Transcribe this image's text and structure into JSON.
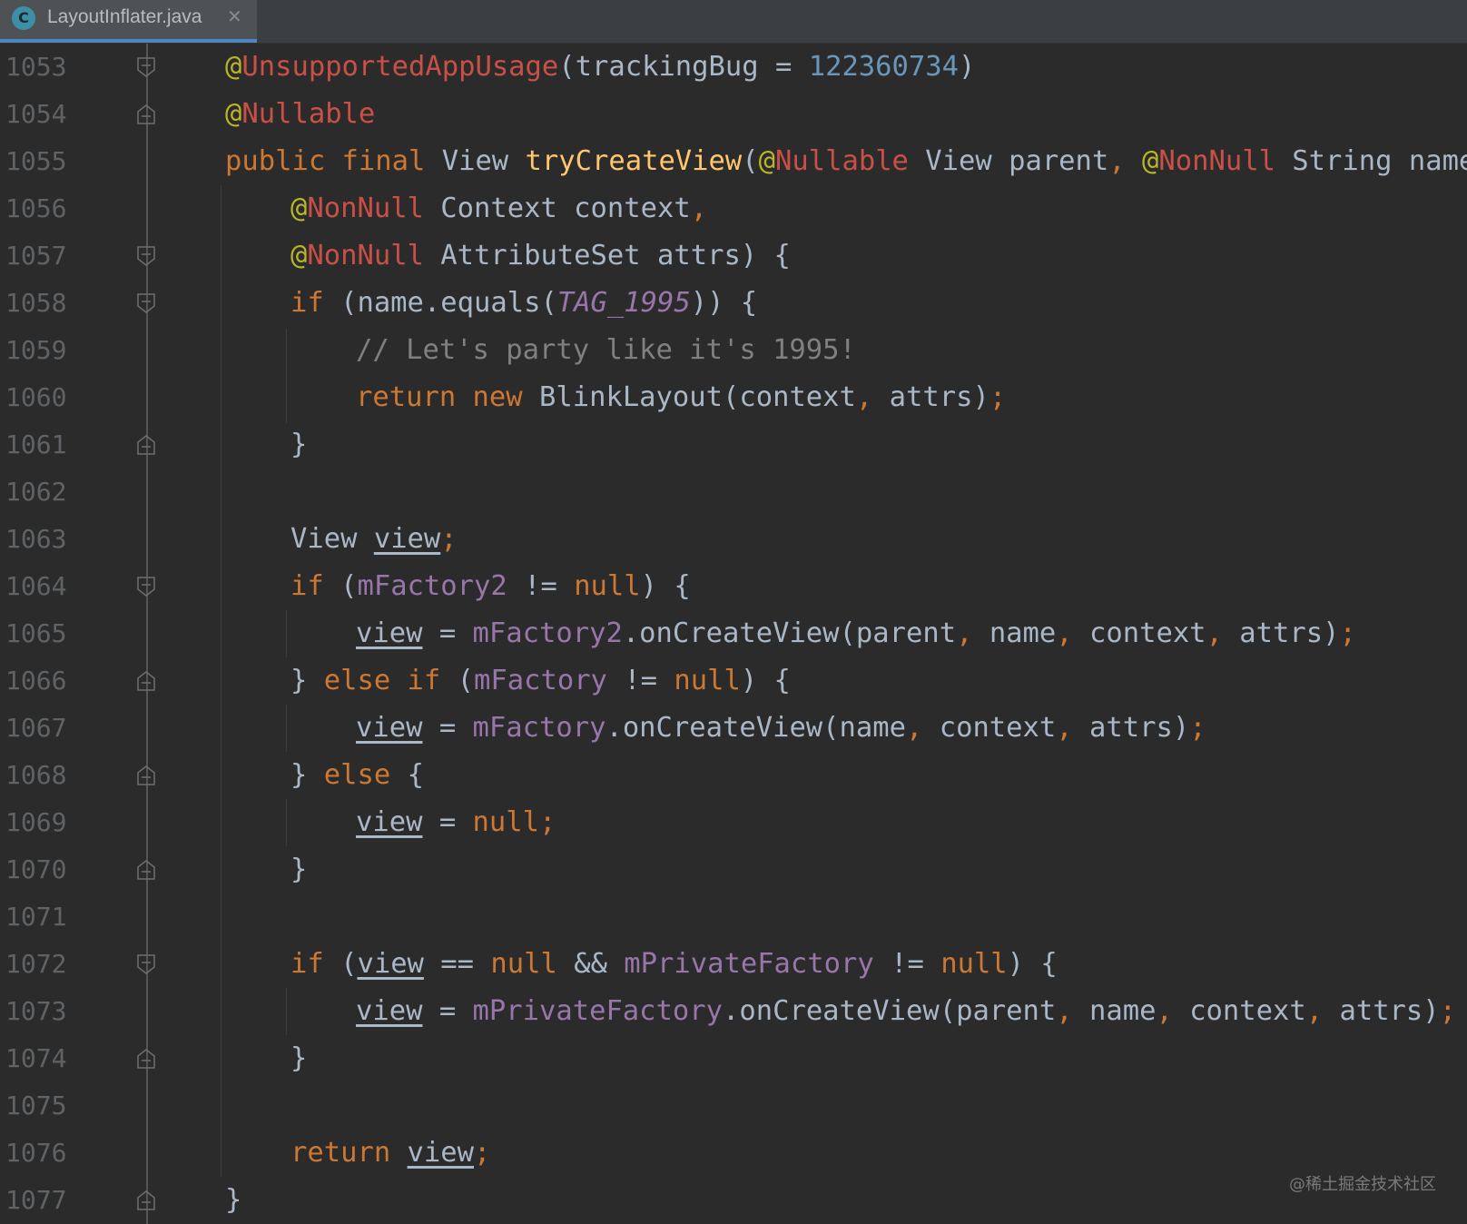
{
  "tab": {
    "icon_letter": "C",
    "filename": "LayoutInflater.java",
    "close": "✕"
  },
  "colors": {
    "background": "#2B2B2B",
    "keyword": "#CC7832",
    "annotation": "#BBB529",
    "number": "#6897BB",
    "method": "#FFC66D",
    "field": "#9876AA",
    "comment": "#808080",
    "text": "#A9B7C6",
    "tab_accent": "#4A88C7"
  },
  "lines": [
    {
      "n": "1053",
      "fold": "open",
      "indent": 0,
      "tokens": [
        [
          "@",
          "ann-at"
        ],
        [
          "UnsupportedAppUsage",
          "ann"
        ],
        [
          "(trackingBug = ",
          ""
        ],
        [
          "122360734",
          "num"
        ],
        [
          ")",
          ""
        ]
      ]
    },
    {
      "n": "1054",
      "fold": "close",
      "indent": 0,
      "tokens": [
        [
          "@",
          "ann-at"
        ],
        [
          "Nullable",
          "ann"
        ]
      ]
    },
    {
      "n": "1055",
      "fold": "",
      "indent": 0,
      "tokens": [
        [
          "public final ",
          "kw"
        ],
        [
          "View ",
          ""
        ],
        [
          "tryCreateView",
          "fn"
        ],
        [
          "(",
          ""
        ],
        [
          "@",
          "ann-at"
        ],
        [
          "Nullable",
          "ann"
        ],
        [
          " View parent",
          ""
        ],
        [
          ", ",
          "kw"
        ],
        [
          "@",
          "ann-at"
        ],
        [
          "NonNull",
          "ann"
        ],
        [
          " String name",
          ""
        ],
        [
          ",",
          "kw"
        ]
      ]
    },
    {
      "n": "1056",
      "fold": "",
      "indent": 1,
      "tokens": [
        [
          "@",
          "ann-at"
        ],
        [
          "NonNull",
          "ann"
        ],
        [
          " Context context",
          ""
        ],
        [
          ",",
          "kw"
        ]
      ]
    },
    {
      "n": "1057",
      "fold": "open",
      "indent": 1,
      "tokens": [
        [
          "@",
          "ann-at"
        ],
        [
          "NonNull",
          "ann"
        ],
        [
          " AttributeSet attrs) {",
          ""
        ]
      ]
    },
    {
      "n": "1058",
      "fold": "open",
      "indent": 1,
      "tokens": [
        [
          "if ",
          "kw"
        ],
        [
          "(name.equals(",
          ""
        ],
        [
          "TAG_1995",
          "cst"
        ],
        [
          ")) {",
          ""
        ]
      ]
    },
    {
      "n": "1059",
      "fold": "",
      "indent": 2,
      "tokens": [
        [
          "// Let's party like it's 1995!",
          "cm"
        ]
      ]
    },
    {
      "n": "1060",
      "fold": "",
      "indent": 2,
      "tokens": [
        [
          "return new ",
          "kw"
        ],
        [
          "BlinkLayout(context",
          ""
        ],
        [
          ", ",
          "kw"
        ],
        [
          "attrs)",
          ""
        ],
        [
          ";",
          "kw"
        ]
      ]
    },
    {
      "n": "1061",
      "fold": "close",
      "indent": 1,
      "tokens": [
        [
          "}",
          ""
        ]
      ]
    },
    {
      "n": "1062",
      "fold": "",
      "indent": 1,
      "tokens": []
    },
    {
      "n": "1063",
      "fold": "",
      "indent": 1,
      "tokens": [
        [
          "View ",
          ""
        ],
        [
          "view",
          "und"
        ],
        [
          ";",
          "kw"
        ]
      ]
    },
    {
      "n": "1064",
      "fold": "open",
      "indent": 1,
      "tokens": [
        [
          "if ",
          "kw"
        ],
        [
          "(",
          ""
        ],
        [
          "mFactory2",
          "fld"
        ],
        [
          " != ",
          ""
        ],
        [
          "null",
          "kw"
        ],
        [
          ") {",
          ""
        ]
      ]
    },
    {
      "n": "1065",
      "fold": "",
      "indent": 2,
      "tokens": [
        [
          "view",
          "und"
        ],
        [
          " = ",
          ""
        ],
        [
          "mFactory2",
          "fld"
        ],
        [
          ".onCreateView(parent",
          ""
        ],
        [
          ", ",
          "kw"
        ],
        [
          "name",
          ""
        ],
        [
          ", ",
          "kw"
        ],
        [
          "context",
          ""
        ],
        [
          ", ",
          "kw"
        ],
        [
          "attrs)",
          ""
        ],
        [
          ";",
          "kw"
        ]
      ]
    },
    {
      "n": "1066",
      "fold": "close",
      "indent": 1,
      "tokens": [
        [
          "} ",
          ""
        ],
        [
          "else if ",
          "kw"
        ],
        [
          "(",
          ""
        ],
        [
          "mFactory",
          "fld"
        ],
        [
          " != ",
          ""
        ],
        [
          "null",
          "kw"
        ],
        [
          ") {",
          ""
        ]
      ]
    },
    {
      "n": "1067",
      "fold": "",
      "indent": 2,
      "tokens": [
        [
          "view",
          "und"
        ],
        [
          " = ",
          ""
        ],
        [
          "mFactory",
          "fld"
        ],
        [
          ".onCreateView(name",
          ""
        ],
        [
          ", ",
          "kw"
        ],
        [
          "context",
          ""
        ],
        [
          ", ",
          "kw"
        ],
        [
          "attrs)",
          ""
        ],
        [
          ";",
          "kw"
        ]
      ]
    },
    {
      "n": "1068",
      "fold": "close",
      "indent": 1,
      "tokens": [
        [
          "} ",
          ""
        ],
        [
          "else ",
          "kw"
        ],
        [
          "{",
          ""
        ]
      ]
    },
    {
      "n": "1069",
      "fold": "",
      "indent": 2,
      "tokens": [
        [
          "view",
          "und"
        ],
        [
          " = ",
          ""
        ],
        [
          "null",
          "kw"
        ],
        [
          ";",
          "kw"
        ]
      ]
    },
    {
      "n": "1070",
      "fold": "close",
      "indent": 1,
      "tokens": [
        [
          "}",
          ""
        ]
      ]
    },
    {
      "n": "1071",
      "fold": "",
      "indent": 1,
      "tokens": []
    },
    {
      "n": "1072",
      "fold": "open",
      "indent": 1,
      "tokens": [
        [
          "if ",
          "kw"
        ],
        [
          "(",
          ""
        ],
        [
          "view",
          "und"
        ],
        [
          " == ",
          ""
        ],
        [
          "null ",
          "kw"
        ],
        [
          "&& ",
          ""
        ],
        [
          "mPrivateFactory",
          "fld"
        ],
        [
          " != ",
          ""
        ],
        [
          "null",
          "kw"
        ],
        [
          ") {",
          ""
        ]
      ]
    },
    {
      "n": "1073",
      "fold": "",
      "indent": 2,
      "tokens": [
        [
          "view",
          "und"
        ],
        [
          " = ",
          ""
        ],
        [
          "mPrivateFactory",
          "fld"
        ],
        [
          ".onCreateView(parent",
          ""
        ],
        [
          ", ",
          "kw"
        ],
        [
          "name",
          ""
        ],
        [
          ", ",
          "kw"
        ],
        [
          "context",
          ""
        ],
        [
          ", ",
          "kw"
        ],
        [
          "attrs)",
          ""
        ],
        [
          ";",
          "kw"
        ]
      ]
    },
    {
      "n": "1074",
      "fold": "close",
      "indent": 1,
      "tokens": [
        [
          "}",
          ""
        ]
      ]
    },
    {
      "n": "1075",
      "fold": "",
      "indent": 1,
      "tokens": []
    },
    {
      "n": "1076",
      "fold": "",
      "indent": 1,
      "tokens": [
        [
          "return ",
          "kw"
        ],
        [
          "view",
          "und"
        ],
        [
          ";",
          "kw"
        ]
      ]
    },
    {
      "n": "1077",
      "fold": "close",
      "indent": 0,
      "tokens": [
        [
          "}",
          ""
        ]
      ]
    }
  ],
  "watermark": "@稀土掘金技术社区"
}
